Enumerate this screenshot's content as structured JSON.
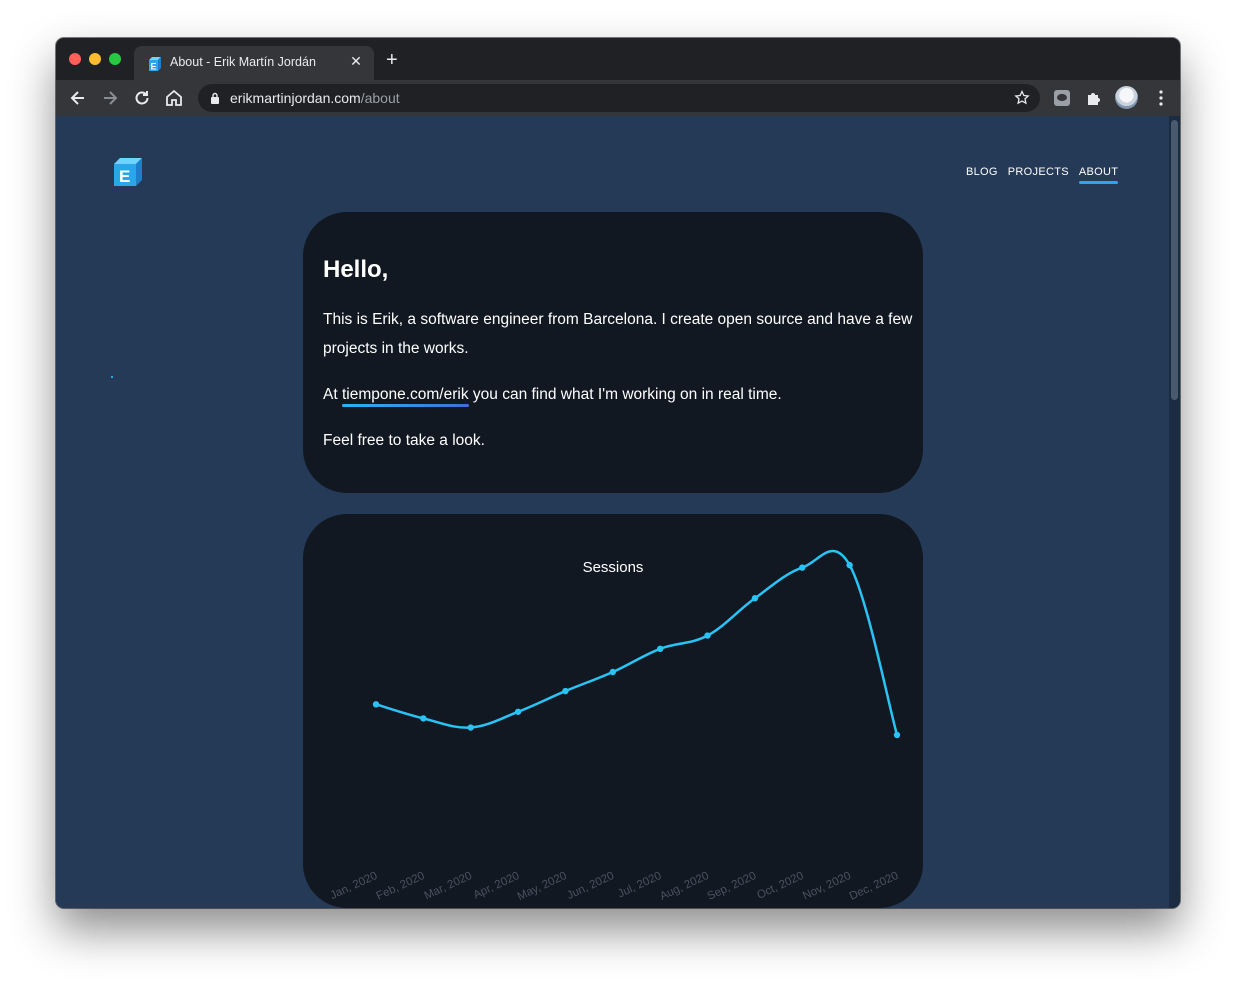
{
  "browser": {
    "tab_title": "About - Erik Martín Jordán",
    "url_domain": "erikmartinjordan.com",
    "url_path": "/about"
  },
  "site": {
    "logo_letter": "E",
    "nav": [
      "BLOG",
      "PROJECTS",
      "ABOUT"
    ],
    "active_nav": "ABOUT"
  },
  "about": {
    "title": "Hello,",
    "intro": "This is Erik, a software engineer from Barcelona. I create open source and have a few projects in the works.",
    "line2_prefix": "At ",
    "line2_link": "tiempone.com/erik",
    "line2_suffix": " you can find what I'm working on in real time.",
    "line3": "Feel free to take a look."
  },
  "colors": {
    "page_bg": "#243a56",
    "card_bg": "#111822",
    "accent": "#2aa7ea",
    "line": "#29c3f5"
  },
  "chart_data": {
    "type": "line",
    "title": "Sessions",
    "categories": [
      "Jan, 2020",
      "Feb, 2020",
      "Mar, 2020",
      "Apr, 2020",
      "May, 2020",
      "Jun, 2020",
      "Jul, 2020",
      "Aug, 2020",
      "Sep, 2020",
      "Oct, 2020",
      "Nov, 2020",
      "Dec, 2020"
    ],
    "values": [
      171,
      154,
      143,
      162,
      187,
      210,
      238,
      254,
      299,
      336,
      339,
      134
    ],
    "ylim": [
      0,
      350
    ],
    "grid": false,
    "legend": false
  }
}
